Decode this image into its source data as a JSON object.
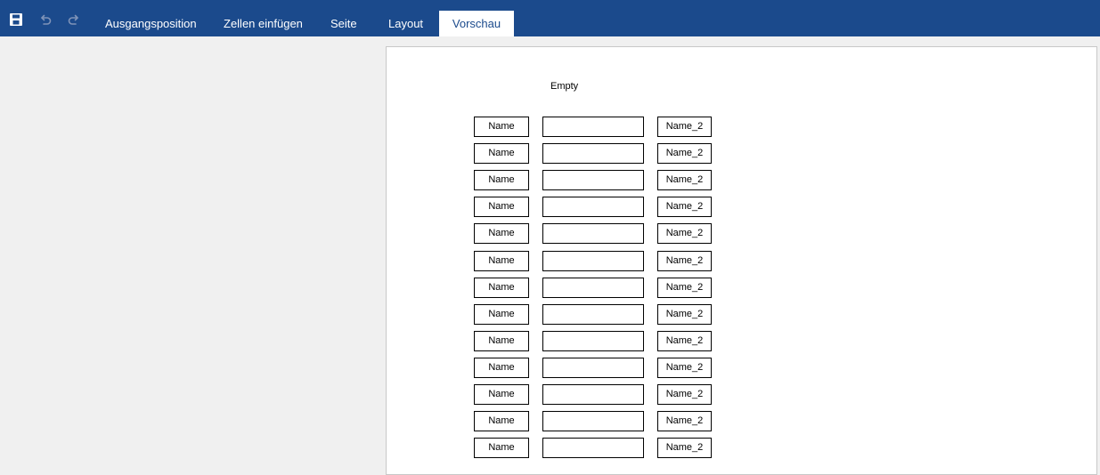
{
  "toolbar": {
    "icons": {
      "save": "save-icon",
      "undo": "undo-icon",
      "redo": "redo-icon"
    },
    "tabs": [
      {
        "label": "Ausgangsposition",
        "active": false
      },
      {
        "label": "Zellen einfügen",
        "active": false
      },
      {
        "label": "Seite",
        "active": false
      },
      {
        "label": "Layout",
        "active": false
      },
      {
        "label": "Vorschau",
        "active": true
      }
    ],
    "colors": {
      "bar": "#1b4a8c",
      "active_tab_bg": "#ffffff"
    }
  },
  "preview": {
    "title": "Empty",
    "rows": [
      {
        "name": "Name",
        "value": "",
        "name2": "Name_2"
      },
      {
        "name": "Name",
        "value": "",
        "name2": "Name_2"
      },
      {
        "name": "Name",
        "value": "",
        "name2": "Name_2"
      },
      {
        "name": "Name",
        "value": "",
        "name2": "Name_2"
      },
      {
        "name": "Name",
        "value": "",
        "name2": "Name_2"
      },
      {
        "name": "Name",
        "value": "",
        "name2": "Name_2"
      },
      {
        "name": "Name",
        "value": "",
        "name2": "Name_2"
      },
      {
        "name": "Name",
        "value": "",
        "name2": "Name_2"
      },
      {
        "name": "Name",
        "value": "",
        "name2": "Name_2"
      },
      {
        "name": "Name",
        "value": "",
        "name2": "Name_2"
      },
      {
        "name": "Name",
        "value": "",
        "name2": "Name_2"
      },
      {
        "name": "Name",
        "value": "",
        "name2": "Name_2"
      },
      {
        "name": "Name",
        "value": "",
        "name2": "Name_2"
      }
    ]
  }
}
